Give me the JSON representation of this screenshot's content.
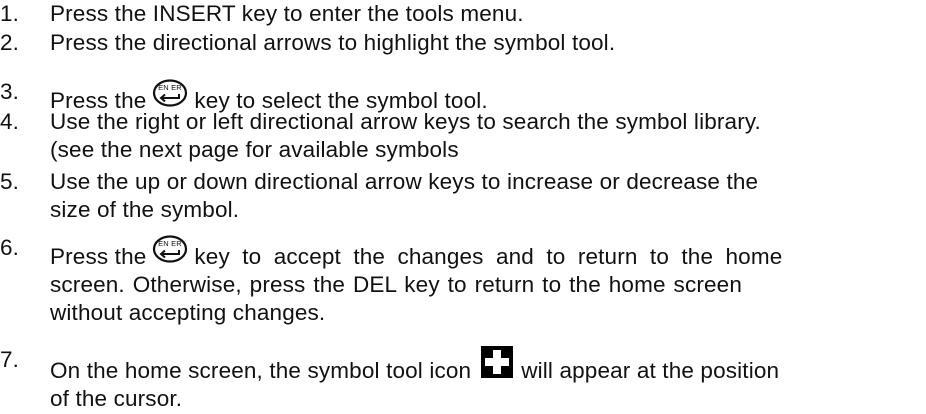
{
  "steps": [
    {
      "num": "1.",
      "text": "Press the INSERT key to enter the tools menu."
    },
    {
      "num": "2.",
      "text": "Press the directional arrows to highlight the symbol tool."
    },
    {
      "num": "3.",
      "before": "Press the",
      "icon": "enter-key-icon",
      "after": "key to select the symbol tool."
    },
    {
      "num": "4.",
      "line1": "Use the right or left directional arrow keys to search the symbol library.",
      "line2": "(see the next page for available symbols"
    },
    {
      "num": "5.",
      "line1": "Use the up or down directional arrow keys to increase or decrease the",
      "line2": "size of the symbol."
    },
    {
      "num": "6.",
      "before": "Press the",
      "icon": "enter-key-icon",
      "after": "key to accept the changes and to return to the home",
      "line2": "screen. Otherwise, press the DEL key to return to the home screen",
      "line3": "without accepting changes."
    },
    {
      "num": "7.",
      "before": "On the home screen, the symbol tool icon",
      "icon": "cross-symbol-icon",
      "after": "will appear at the position",
      "line2": "of the cursor."
    }
  ]
}
